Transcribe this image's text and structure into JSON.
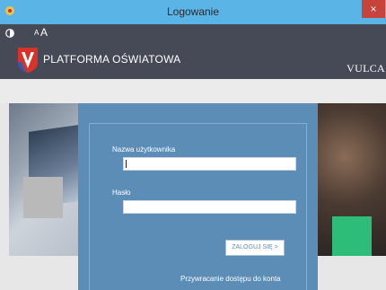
{
  "window": {
    "title": "Logowanie",
    "close_glyph": "×",
    "icon": "app-icon"
  },
  "header": {
    "contrast_icon": "contrast-icon",
    "font_small": "A",
    "font_large": "A",
    "logo_icon": "shield-logo-icon",
    "brand": "PLATFORMA OŚWIATOWA",
    "vendor": "VULCA"
  },
  "form": {
    "username_label": "Nazwa użytkownika",
    "username_value": "",
    "password_label": "Hasło",
    "password_value": "",
    "login_button": "ZALOGUJ SIĘ >",
    "recover_link": "Przywracanie dostępu do konta"
  },
  "colors": {
    "titlebar": "#5bb4e6",
    "header": "#464a57",
    "panel": "#5b8db7",
    "close": "#c8433b",
    "accent_green": "#2ebd79",
    "logo_red": "#d8322b",
    "logo_blue": "#2d5bb8"
  }
}
